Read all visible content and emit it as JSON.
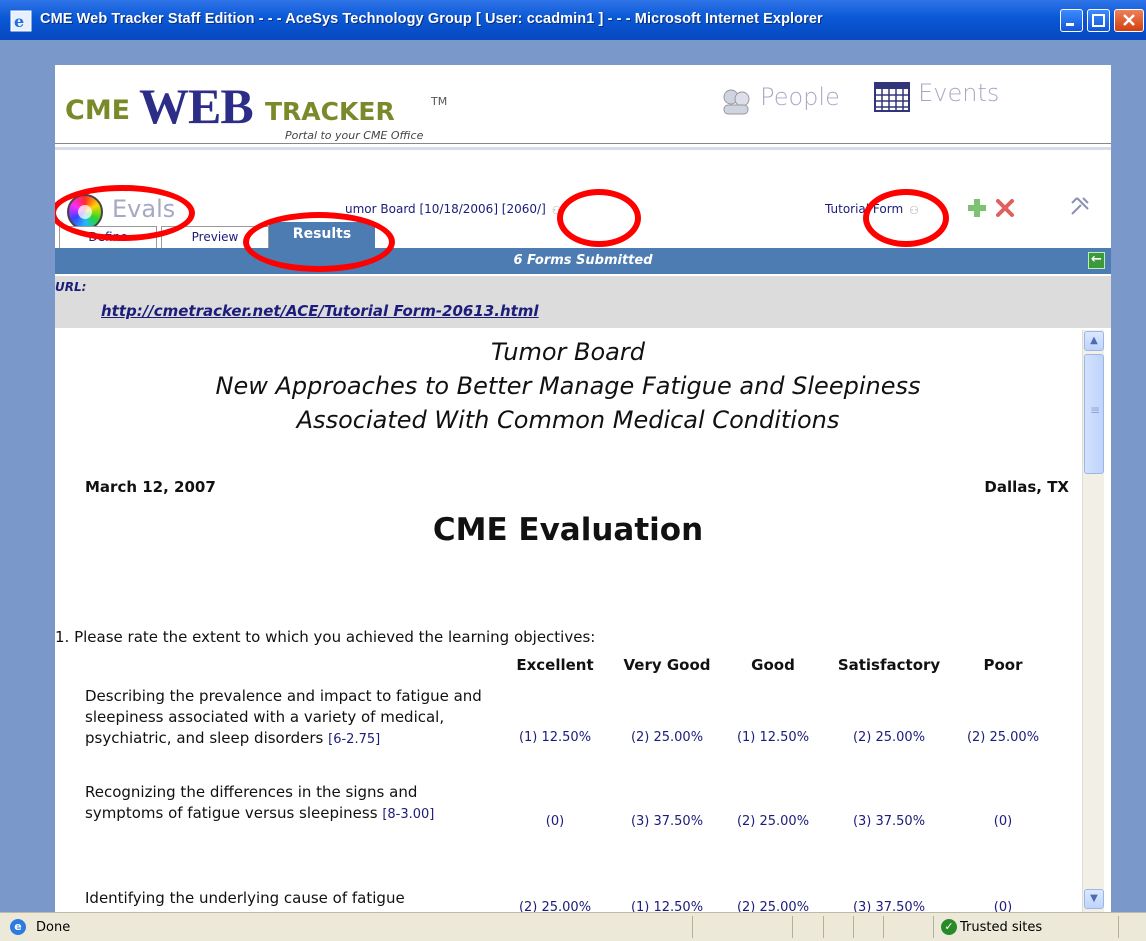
{
  "window": {
    "title": "CME Web Tracker Staff Edition - - - AceSys Technology Group [ User: ccadmin1 ] - - - Microsoft Internet Explorer"
  },
  "header": {
    "logo_cme": "CME",
    "logo_web": "WEB",
    "logo_tracker": "TRACKER",
    "logo_tm": "TM",
    "tagline": "Portal to your CME Office",
    "people_label": "People",
    "events_label": "Events"
  },
  "toolbar": {
    "evals_label": "Evals",
    "event_link": "umor Board [10/18/2006] [2060/]",
    "form_link": "Tutorial Form"
  },
  "tabs": [
    {
      "label": "Define"
    },
    {
      "label": "Preview"
    },
    {
      "label": "Results",
      "active": true
    }
  ],
  "results_bar": "6 Forms Submitted",
  "url": {
    "label": "URL:",
    "link": "http://cmetracker.net/ACE/Tutorial Form-20613.html"
  },
  "document": {
    "title_lines": [
      "Tumor Board",
      "New Approaches to Better Manage Fatigue and Sleepiness",
      "Associated With Common Medical Conditions"
    ],
    "date": "March 12, 2007",
    "location": "Dallas, TX",
    "heading": "CME Evaluation",
    "question": "1. Please rate the extent to which you achieved the learning objectives:",
    "columns": [
      "Excellent",
      "Very Good",
      "Good",
      "Satisfactory",
      "Poor"
    ],
    "rows": [
      {
        "text": "Describing the prevalence and impact to fatigue and sleepiness associated with a variety of medical, psychiatric, and sleep disorders",
        "ref": "[6-2.75]",
        "cells": [
          "(1) 12.50%",
          "(2) 25.00%",
          "(1) 12.50%",
          "(2) 25.00%",
          "(2) 25.00%"
        ]
      },
      {
        "text": "Recognizing the differences in the signs and symptoms of fatigue versus sleepiness",
        "ref": "[8-3.00]",
        "cells": [
          "(0)",
          "(3) 37.50%",
          "(2) 25.00%",
          "(3) 37.50%",
          "(0)"
        ]
      },
      {
        "text": "Identifying the underlying cause of fatigue",
        "ref": "",
        "cells": [
          "(2) 25.00%",
          "(1) 12.50%",
          "(2) 25.00%",
          "(3) 37.50%",
          "(0)"
        ]
      }
    ]
  },
  "status": {
    "text": "Done",
    "zone": "Trusted sites"
  }
}
